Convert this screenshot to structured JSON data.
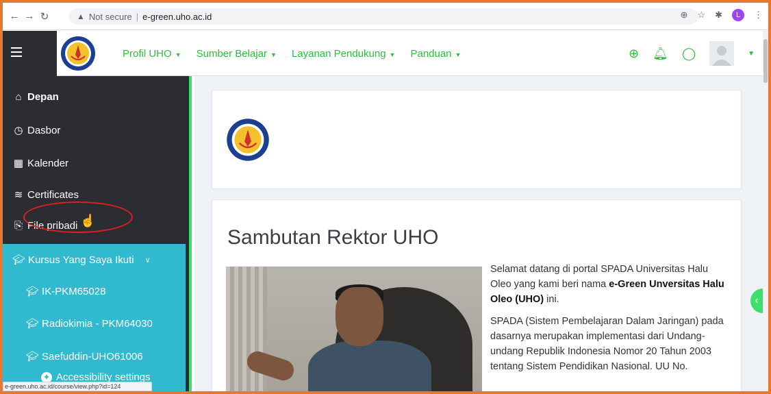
{
  "browser": {
    "security_label": "Not secure",
    "url": "e-green.uho.ac.id",
    "profile_initial": "L",
    "status_url": "e-green.uho.ac.id/course/view.php?id=124"
  },
  "header": {
    "menu": [
      {
        "label": "Profil UHO"
      },
      {
        "label": "Sumber Belajar"
      },
      {
        "label": "Layanan Pendukung"
      },
      {
        "label": "Panduan"
      }
    ]
  },
  "sidebar": {
    "items": [
      {
        "label": "Depan",
        "icon": "home-icon"
      },
      {
        "label": "Dasbor",
        "icon": "dashboard-icon"
      },
      {
        "label": "Kalender",
        "icon": "calendar-icon"
      },
      {
        "label": "Certificates",
        "icon": "certificates-icon"
      },
      {
        "label": "File pribadi",
        "icon": "files-icon"
      }
    ],
    "courses_header": "Kursus Yang Saya Ikuti",
    "courses": [
      {
        "label": "IK-PKM65028"
      },
      {
        "label": "Radiokimia - PKM64030"
      },
      {
        "label": "Saefuddin-UHO61006"
      }
    ],
    "accessibility": "Accessibility settings"
  },
  "main": {
    "welcome_title": "Sambutan Rektor UHO",
    "para1_a": "Selamat datang di portal SPADA Universitas Halu Oleo yang kami beri nama ",
    "para1_b": "e-Green Unversitas Halu Oleo (UHO)",
    "para1_c": " ini.",
    "para2": "SPADA (Sistem Pembelajaran Dalam Jaringan) pada dasarnya merupakan implementasi dari Undang-undang Republik Indonesia Nomor 20 Tahun 2003 tentang Sistem Pendidikan Nasional. UU No."
  },
  "colors": {
    "accent_green": "#2dbd3a",
    "sidebar_dark": "#2b2d33",
    "course_cyan": "#31b9cf",
    "frame_orange": "#e8782e"
  }
}
